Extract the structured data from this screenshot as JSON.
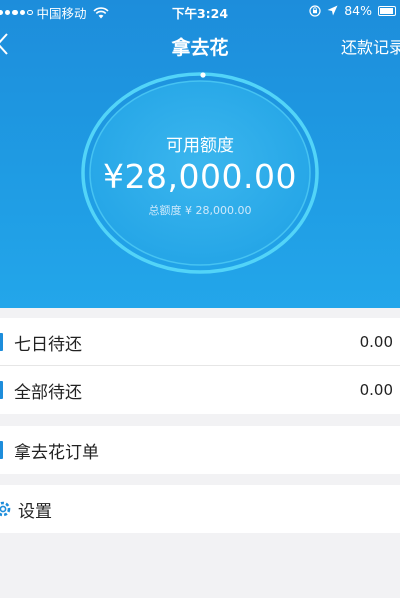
{
  "status_bar": {
    "carrier": "中国移动",
    "time": "下午3:24",
    "battery": "84%"
  },
  "nav": {
    "title": "拿去花",
    "right_action": "还款记录"
  },
  "credit": {
    "available_label": "可用额度",
    "available_amount": "¥28,000.00",
    "total_text": "总额度 ¥ 28,000.00"
  },
  "list": {
    "seven_day": {
      "label": "七日待还",
      "value": "0.00"
    },
    "all_due": {
      "label": "全部待还",
      "value": "0.00"
    },
    "orders": {
      "label": "拿去花订单"
    },
    "settings": {
      "label": "设置"
    }
  },
  "colors": {
    "accent": "#1d8ddb",
    "hero_bottom": "#23a6ea",
    "background": "#f2f2f4"
  }
}
